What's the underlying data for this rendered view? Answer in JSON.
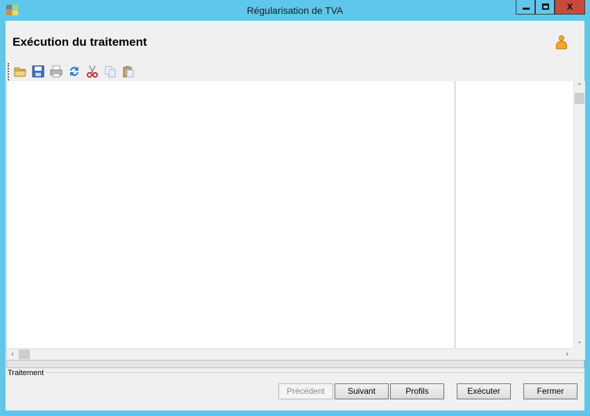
{
  "window": {
    "title": "Régularisation de TVA",
    "controls": {
      "minimize": "",
      "maximize": "",
      "close": "X"
    }
  },
  "page": {
    "heading": "Exécution du traitement",
    "user_icon": "user-icon"
  },
  "toolbar": {
    "items": [
      {
        "name": "open",
        "icon": "folder-open-icon"
      },
      {
        "name": "save",
        "icon": "floppy-disk-icon"
      },
      {
        "name": "print",
        "icon": "printer-icon"
      },
      {
        "name": "refresh",
        "icon": "refresh-arrows-icon"
      },
      {
        "name": "cut",
        "icon": "scissors-icon"
      },
      {
        "name": "copy",
        "icon": "copy-icon"
      },
      {
        "name": "paste",
        "icon": "clipboard-icon"
      }
    ]
  },
  "progress": {
    "value": 0
  },
  "group": {
    "label": "Traitement"
  },
  "buttons": {
    "previous": {
      "label": "Précédent",
      "enabled": false
    },
    "next": {
      "label": "Suivant",
      "enabled": true
    },
    "profiles": {
      "label": "Profils",
      "enabled": true
    },
    "execute": {
      "label": "Exécuter",
      "enabled": true
    },
    "close": {
      "label": "Fermer",
      "enabled": true
    }
  },
  "colors": {
    "title_bar": "#5fc7ec",
    "close_button": "#c74a3a",
    "client_background": "#f0f0f0",
    "user_icon": "#f5a623"
  }
}
